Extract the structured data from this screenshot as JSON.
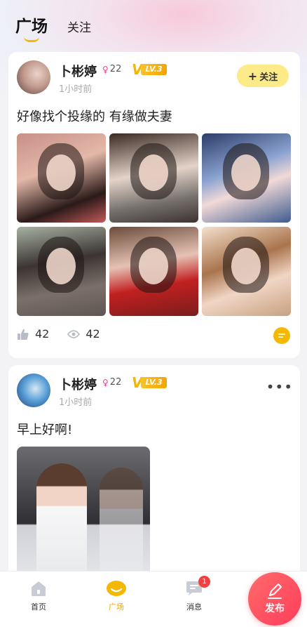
{
  "tabs": {
    "active": "广场",
    "other": "关注"
  },
  "posts": [
    {
      "user_name": "卜彬婷",
      "age": "22",
      "level": "LV.3",
      "time": "1小时前",
      "follow_label": "关注",
      "text": "好像找个投缘的 有缘做夫妻",
      "likes": "42",
      "views": "42"
    },
    {
      "user_name": "卜彬婷",
      "age": "22",
      "level": "LV.3",
      "time": "1小时前",
      "text": "早上好啊!"
    }
  ],
  "nav": {
    "home": "首页",
    "square": "广场",
    "messages": "消息",
    "message_badge": "1",
    "publish": "发布"
  },
  "colors": {
    "accent": "#f5b800",
    "publish": "#ff4b5c",
    "badge": "#f04040"
  }
}
